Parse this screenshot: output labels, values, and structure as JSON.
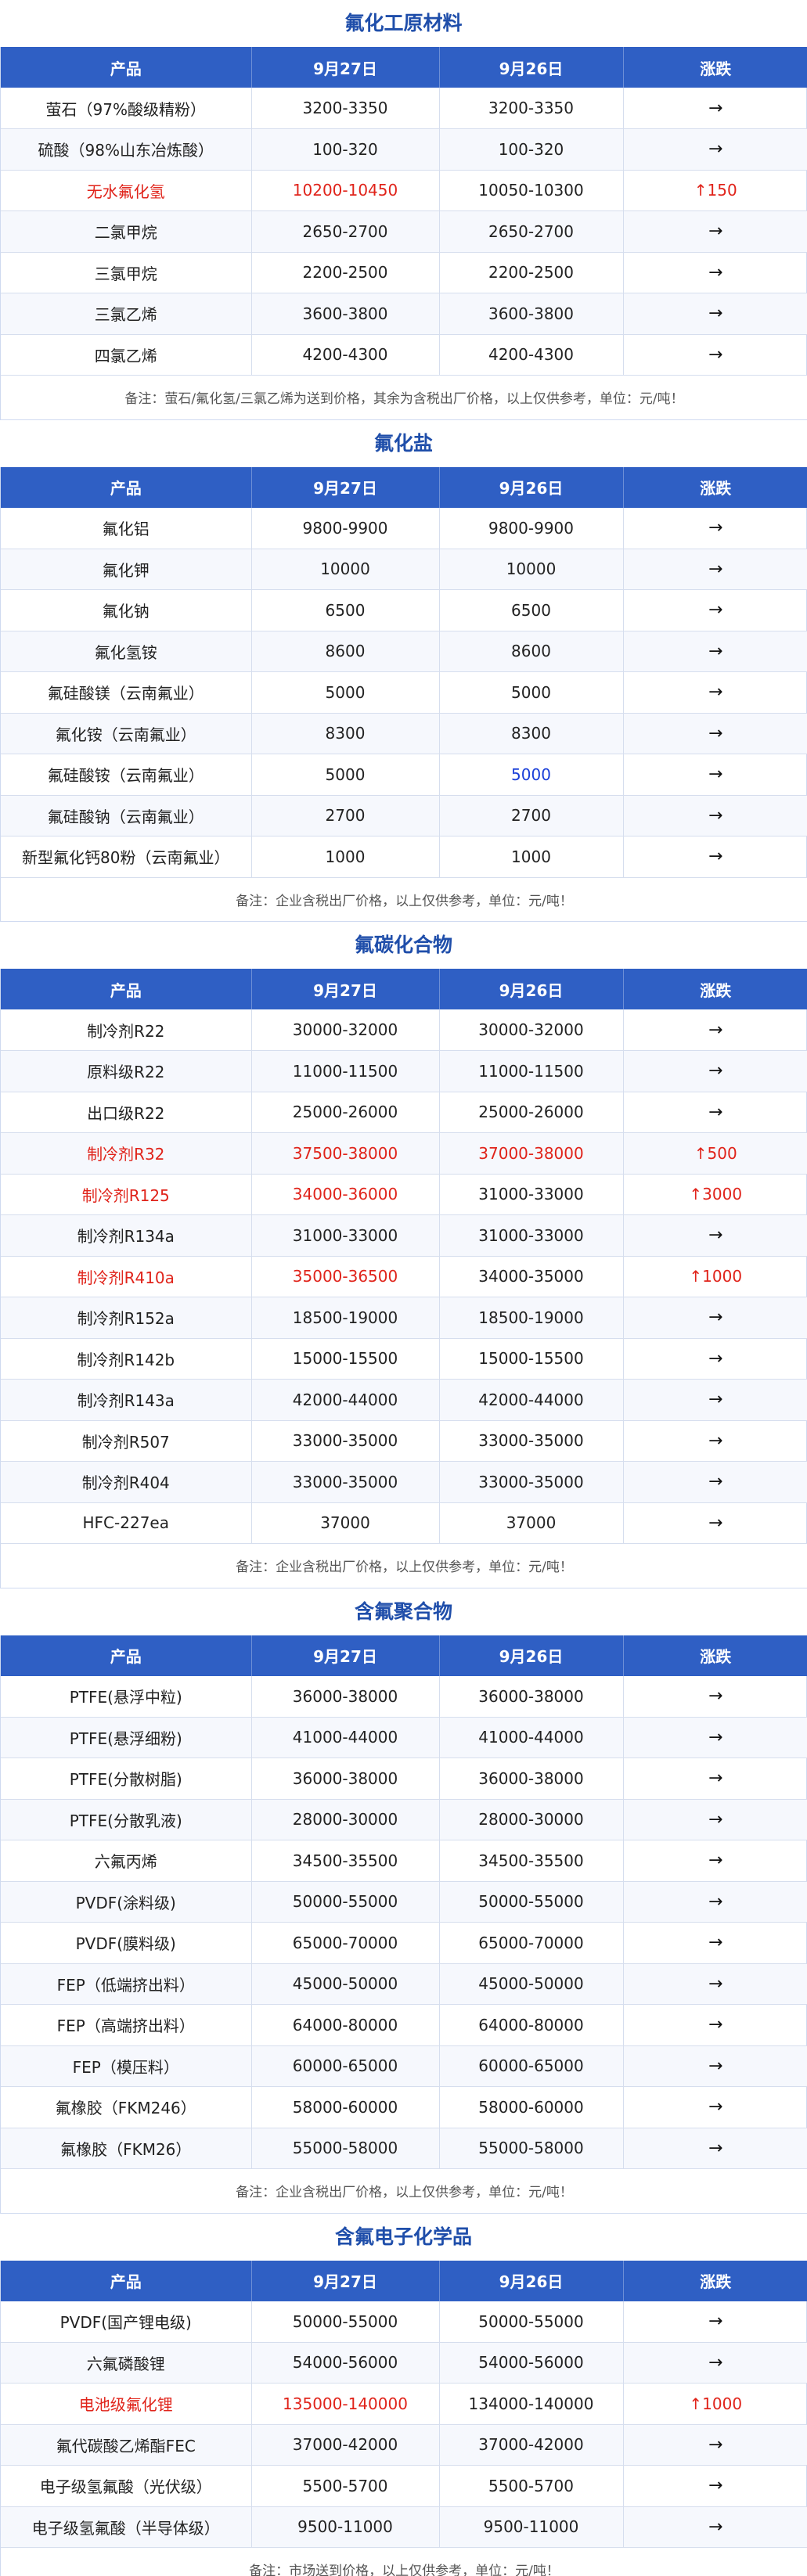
{
  "headers": [
    "产品",
    "9月27日",
    "9月26日",
    "涨跌"
  ],
  "arrow_flat": "→",
  "sections": [
    {
      "title": "氟化工原材料",
      "rows": [
        {
          "product": "萤石（97%酸级精粉）",
          "d27": "3200-3350",
          "d26": "3200-3350",
          "chg": ""
        },
        {
          "product": "硫酸（98%山东冶炼酸）",
          "d27": "100-320",
          "d26": "100-320",
          "chg": ""
        },
        {
          "product": "无水氟化氢",
          "d27": "10200-10450",
          "d26": "10050-10300",
          "chg": "↑150",
          "red_cols": [
            0,
            1,
            3
          ]
        },
        {
          "product": "二氯甲烷",
          "d27": "2650-2700",
          "d26": "2650-2700",
          "chg": ""
        },
        {
          "product": "三氯甲烷",
          "d27": "2200-2500",
          "d26": "2200-2500",
          "chg": ""
        },
        {
          "product": "三氯乙烯",
          "d27": "3600-3800",
          "d26": "3600-3800",
          "chg": ""
        },
        {
          "product": "四氯乙烯",
          "d27": "4200-4300",
          "d26": "4200-4300",
          "chg": ""
        }
      ],
      "note": "备注：萤石/氟化氢/三氯乙烯为送到价格，其余为含税出厂价格，以上仅供参考，单位：元/吨！"
    },
    {
      "title": "氟化盐",
      "rows": [
        {
          "product": "氟化铝",
          "d27": "9800-9900",
          "d26": "9800-9900",
          "chg": ""
        },
        {
          "product": "氟化钾",
          "d27": "10000",
          "d26": "10000",
          "chg": ""
        },
        {
          "product": "氟化钠",
          "d27": "6500",
          "d26": "6500",
          "chg": ""
        },
        {
          "product": "氟化氢铵",
          "d27": "8600",
          "d26": "8600",
          "chg": ""
        },
        {
          "product": "氟硅酸镁（云南氟业）",
          "d27": "5000",
          "d26": "5000",
          "chg": ""
        },
        {
          "product": "氟化铵（云南氟业）",
          "d27": "8300",
          "d26": "8300",
          "chg": ""
        },
        {
          "product": "氟硅酸铵（云南氟业）",
          "d27": "5000",
          "d26": "5000",
          "chg": "",
          "blue_cols": [
            2
          ]
        },
        {
          "product": "氟硅酸钠（云南氟业）",
          "d27": "2700",
          "d26": "2700",
          "chg": ""
        },
        {
          "product": "新型氟化钙80粉（云南氟业）",
          "d27": "1000",
          "d26": "1000",
          "chg": ""
        }
      ],
      "note": "备注：企业含税出厂价格，以上仅供参考，单位：元/吨！"
    },
    {
      "title": "氟碳化合物",
      "rows": [
        {
          "product": "制冷剂R22",
          "d27": "30000-32000",
          "d26": "30000-32000",
          "chg": ""
        },
        {
          "product": "原料级R22",
          "d27": "11000-11500",
          "d26": "11000-11500",
          "chg": ""
        },
        {
          "product": "出口级R22",
          "d27": "25000-26000",
          "d26": "25000-26000",
          "chg": ""
        },
        {
          "product": "制冷剂R32",
          "d27": "37500-38000",
          "d26": "37000-38000",
          "chg": "↑500",
          "red_cols": [
            0,
            1,
            2,
            3
          ]
        },
        {
          "product": "制冷剂R125",
          "d27": "34000-36000",
          "d26": "31000-33000",
          "chg": "↑3000",
          "red_cols": [
            0,
            1,
            3
          ]
        },
        {
          "product": "制冷剂R134a",
          "d27": "31000-33000",
          "d26": "31000-33000",
          "chg": ""
        },
        {
          "product": "制冷剂R410a",
          "d27": "35000-36500",
          "d26": "34000-35000",
          "chg": "↑1000",
          "red_cols": [
            0,
            1,
            3
          ]
        },
        {
          "product": "制冷剂R152a",
          "d27": "18500-19000",
          "d26": "18500-19000",
          "chg": ""
        },
        {
          "product": "制冷剂R142b",
          "d27": "15000-15500",
          "d26": "15000-15500",
          "chg": ""
        },
        {
          "product": "制冷剂R143a",
          "d27": "42000-44000",
          "d26": "42000-44000",
          "chg": ""
        },
        {
          "product": "制冷剂R507",
          "d27": "33000-35000",
          "d26": "33000-35000",
          "chg": ""
        },
        {
          "product": "制冷剂R404",
          "d27": "33000-35000",
          "d26": "33000-35000",
          "chg": ""
        },
        {
          "product": "HFC-227ea",
          "d27": "37000",
          "d26": "37000",
          "chg": ""
        }
      ],
      "note": "备注：企业含税出厂价格，以上仅供参考，单位：元/吨！"
    },
    {
      "title": "含氟聚合物",
      "rows": [
        {
          "product": "PTFE(悬浮中粒)",
          "d27": "36000-38000",
          "d26": "36000-38000",
          "chg": ""
        },
        {
          "product": "PTFE(悬浮细粉)",
          "d27": "41000-44000",
          "d26": "41000-44000",
          "chg": ""
        },
        {
          "product": "PTFE(分散树脂)",
          "d27": "36000-38000",
          "d26": "36000-38000",
          "chg": ""
        },
        {
          "product": "PTFE(分散乳液)",
          "d27": "28000-30000",
          "d26": "28000-30000",
          "chg": ""
        },
        {
          "product": "六氟丙烯",
          "d27": "34500-35500",
          "d26": "34500-35500",
          "chg": ""
        },
        {
          "product": "PVDF(涂料级)",
          "d27": "50000-55000",
          "d26": "50000-55000",
          "chg": ""
        },
        {
          "product": "PVDF(膜料级)",
          "d27": "65000-70000",
          "d26": "65000-70000",
          "chg": ""
        },
        {
          "product": "FEP（低端挤出料）",
          "d27": "45000-50000",
          "d26": "45000-50000",
          "chg": ""
        },
        {
          "product": "FEP（高端挤出料）",
          "d27": "64000-80000",
          "d26": "64000-80000",
          "chg": ""
        },
        {
          "product": "FEP（模压料）",
          "d27": "60000-65000",
          "d26": "60000-65000",
          "chg": ""
        },
        {
          "product": "氟橡胶（FKM246）",
          "d27": "58000-60000",
          "d26": "58000-60000",
          "chg": ""
        },
        {
          "product": "氟橡胶（FKM26）",
          "d27": "55000-58000",
          "d26": "55000-58000",
          "chg": ""
        }
      ],
      "note": "备注：企业含税出厂价格，以上仅供参考，单位：元/吨！"
    },
    {
      "title": "含氟电子化学品",
      "rows": [
        {
          "product": "PVDF(国产锂电级)",
          "d27": "50000-55000",
          "d26": "50000-55000",
          "chg": ""
        },
        {
          "product": "六氟磷酸锂",
          "d27": "54000-56000",
          "d26": "54000-56000",
          "chg": ""
        },
        {
          "product": "电池级氟化锂",
          "d27": "135000-140000",
          "d26": "134000-140000",
          "chg": "↑1000",
          "red_cols": [
            0,
            1,
            3
          ]
        },
        {
          "product": "氟代碳酸乙烯酯FEC",
          "d27": "37000-42000",
          "d26": "37000-42000",
          "chg": ""
        },
        {
          "product": "电子级氢氟酸（光伏级）",
          "d27": "5500-5700",
          "d26": "5500-5700",
          "chg": ""
        },
        {
          "product": "电子级氢氟酸（半导体级）",
          "d27": "9500-11000",
          "d26": "9500-11000",
          "chg": ""
        }
      ],
      "note": "备注：市场送到价格，以上仅供参考，单位：元/吨！"
    }
  ]
}
